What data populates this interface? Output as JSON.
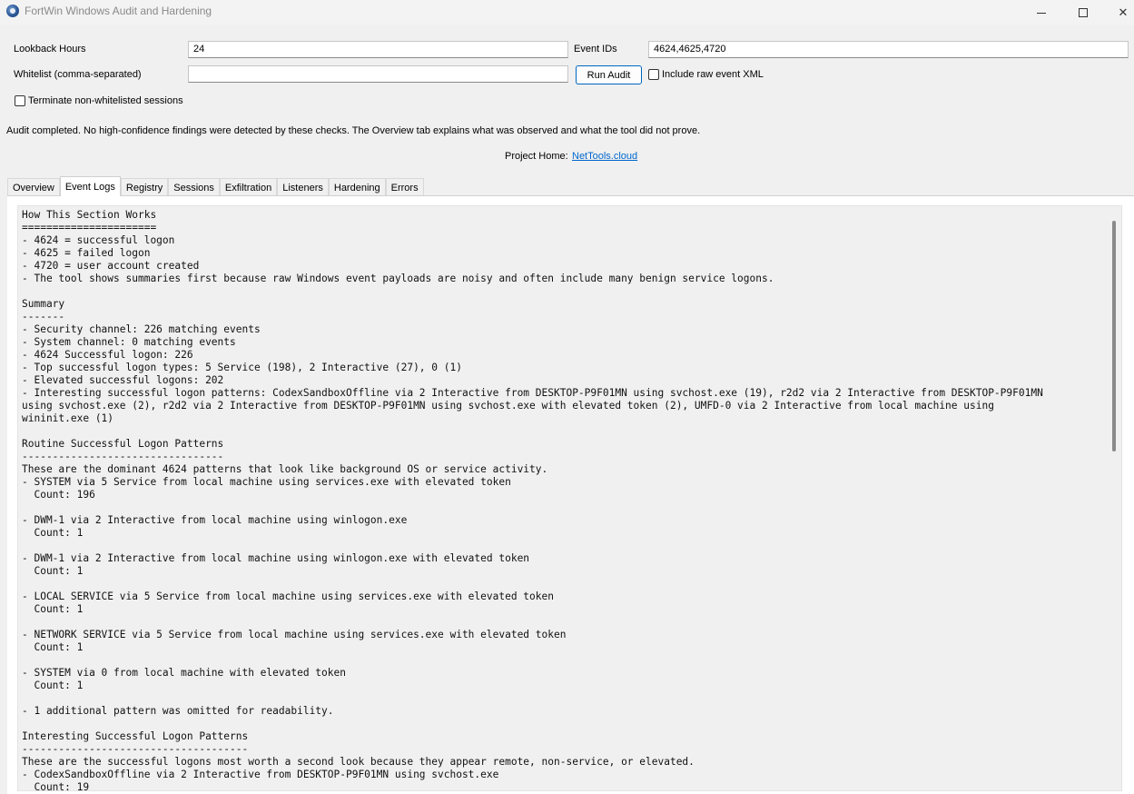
{
  "window": {
    "title": "FortWin Windows Audit and Hardening",
    "icon": "shield-globe-icon",
    "minimize_glyph": "",
    "maximize_glyph": "",
    "close_glyph": "✕"
  },
  "form": {
    "lookback_label": "Lookback Hours",
    "lookback_value": "24",
    "event_ids_label": "Event IDs",
    "event_ids_value": "4624,4625,4720",
    "whitelist_label": "Whitelist (comma-separated)",
    "whitelist_value": "",
    "run_audit_label": "Run Audit",
    "include_raw_label": "Include raw event XML",
    "terminate_label": "Terminate non-whitelisted sessions"
  },
  "status": {
    "message": "Audit completed. No high-confidence findings were detected by these checks. The Overview tab explains what was observed and what the tool did not prove.",
    "project_home_label": "Project Home:",
    "project_home_link": "NetTools.cloud"
  },
  "tabs": [
    "Overview",
    "Event Logs",
    "Registry",
    "Sessions",
    "Exfiltration",
    "Listeners",
    "Hardening",
    "Errors"
  ],
  "active_tab": "Event Logs",
  "log_lines": [
    "How This Section Works",
    "======================",
    "- 4624 = successful logon",
    "- 4625 = failed logon",
    "- 4720 = user account created",
    "- The tool shows summaries first because raw Windows event payloads are noisy and often include many benign service logons.",
    "",
    "Summary",
    "-------",
    "- Security channel: 226 matching events",
    "- System channel: 0 matching events",
    "- 4624 Successful logon: 226",
    "- Top successful logon types: 5 Service (198), 2 Interactive (27), 0 (1)",
    "- Elevated successful logons: 202",
    "- Interesting successful logon patterns: CodexSandboxOffline via 2 Interactive from DESKTOP-P9F01MN using svchost.exe (19), r2d2 via 2 Interactive from DESKTOP-P9F01MN",
    "using svchost.exe (2), r2d2 via 2 Interactive from DESKTOP-P9F01MN using svchost.exe with elevated token (2), UMFD-0 via 2 Interactive from local machine using",
    "wininit.exe (1)",
    "",
    "Routine Successful Logon Patterns",
    "---------------------------------",
    "These are the dominant 4624 patterns that look like background OS or service activity.",
    "- SYSTEM via 5 Service from local machine using services.exe with elevated token",
    "  Count: 196",
    "",
    "- DWM-1 via 2 Interactive from local machine using winlogon.exe",
    "  Count: 1",
    "",
    "- DWM-1 via 2 Interactive from local machine using winlogon.exe with elevated token",
    "  Count: 1",
    "",
    "- LOCAL SERVICE via 5 Service from local machine using services.exe with elevated token",
    "  Count: 1",
    "",
    "- NETWORK SERVICE via 5 Service from local machine using services.exe with elevated token",
    "  Count: 1",
    "",
    "- SYSTEM via 0 from local machine with elevated token",
    "  Count: 1",
    "",
    "- 1 additional pattern was omitted for readability.",
    "",
    "Interesting Successful Logon Patterns",
    "-------------------------------------",
    "These are the successful logons most worth a second look because they appear remote, non-service, or elevated.",
    "- CodexSandboxOffline via 2 Interactive from DESKTOP-P9F01MN using svchost.exe",
    "  Count: 19"
  ]
}
